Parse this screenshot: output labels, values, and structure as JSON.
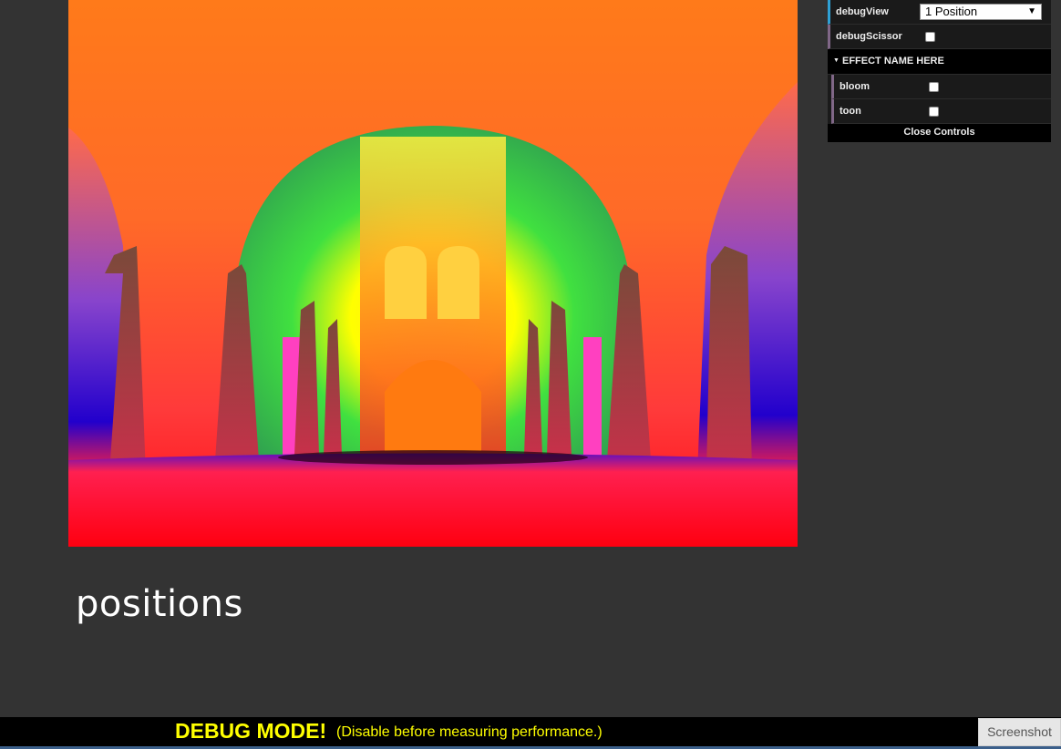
{
  "viewport": {
    "caption": "positions"
  },
  "gui": {
    "debug_view_label": "debugView",
    "debug_view_value": "1 Position",
    "debug_scissor_label": "debugScissor",
    "folder_title": "EFFECT NAME HERE",
    "bloom_label": "bloom",
    "toon_label": "toon",
    "close_label": "Close Controls"
  },
  "debug": {
    "title": "DEBUG MODE!",
    "note": "(Disable before measuring performance.)",
    "screenshot_label": "Screenshot"
  },
  "colors": {
    "accent_select": "#2fa1d6",
    "accent_bool": "#806787",
    "debug_text": "#ffff00",
    "background": "#333333"
  }
}
